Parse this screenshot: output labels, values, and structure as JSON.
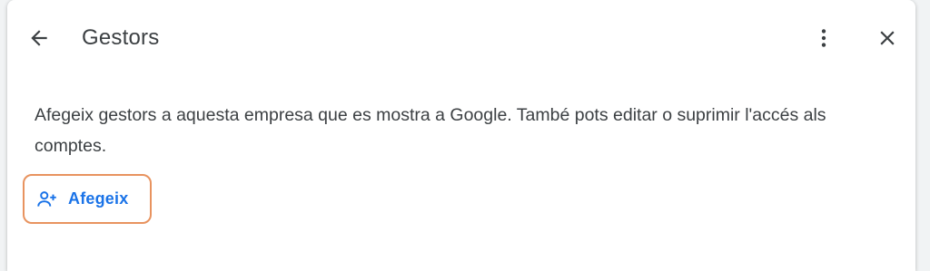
{
  "header": {
    "title": "Gestors",
    "back_icon": "arrow-back-icon",
    "more_icon": "more-vert-icon",
    "close_icon": "close-icon"
  },
  "content": {
    "description": "Afegeix gestors a aquesta empresa que es mostra a Google. També pots editar o suprimir l'accés als comptes.",
    "add_button": {
      "label": "Afegeix",
      "icon": "person-add-icon",
      "color": "#1a73e8",
      "highlight_color": "#e8935f"
    }
  }
}
